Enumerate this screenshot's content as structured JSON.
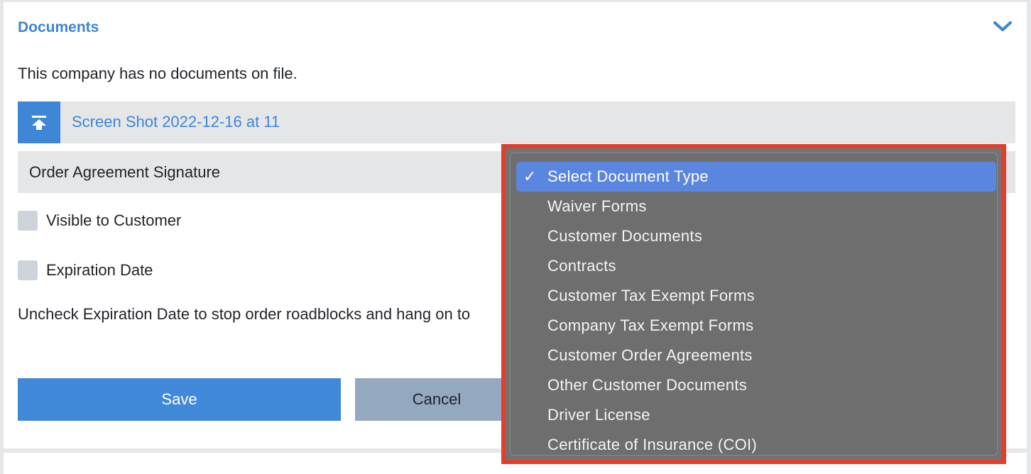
{
  "section": {
    "title": "Documents",
    "empty_message": "This company has no documents on file."
  },
  "upload": {
    "filename": "Screen Shot 2022-12-16 at 11"
  },
  "document_name": {
    "value": "Order Agreement Signature"
  },
  "checkboxes": {
    "visible_to_customer": "Visible to Customer",
    "expiration_date": "Expiration Date"
  },
  "hint": "Uncheck Expiration Date to stop order roadblocks and hang on to",
  "buttons": {
    "save": "Save",
    "cancel": "Cancel"
  },
  "dropdown": {
    "selected": "Select Document Type",
    "options": [
      "Select Document Type",
      "Waiver Forms",
      "Customer Documents",
      "Contracts",
      "Customer Tax Exempt Forms",
      "Company Tax Exempt Forms",
      "Customer Order Agreements",
      "Other Customer Documents",
      "Driver License",
      "Certificate of Insurance (COI)"
    ]
  },
  "colors": {
    "accent": "#3a85d4",
    "highlight_border": "#e33d2b",
    "selected_option": "#5b86df"
  }
}
